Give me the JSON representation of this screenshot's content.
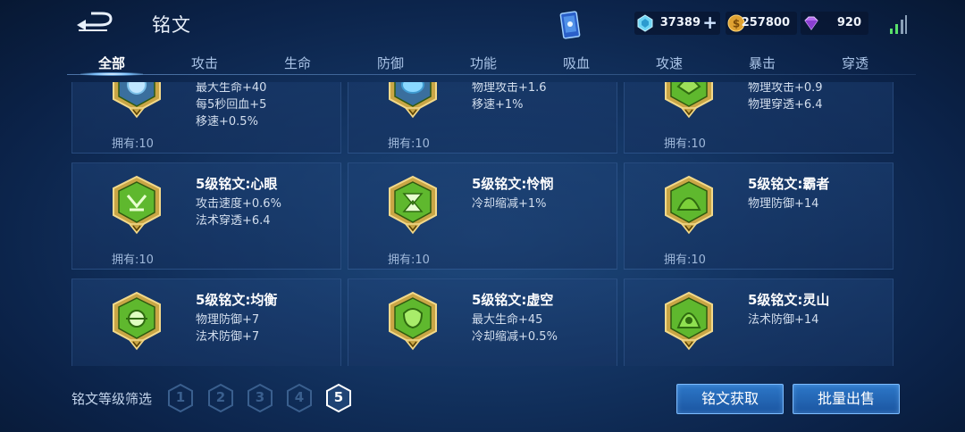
{
  "header": {
    "title": "铭文",
    "resources": [
      {
        "name": "gem",
        "icon": "gem-icon",
        "value": "37389"
      },
      {
        "name": "gold",
        "icon": "gold-coin-icon",
        "value": "257800"
      },
      {
        "name": "diamond",
        "icon": "purple-diamond-icon",
        "value": "920"
      }
    ],
    "plus": "+"
  },
  "tabs": [
    "全部",
    "攻击",
    "生命",
    "防御",
    "功能",
    "吸血",
    "攻速",
    "暴击",
    "穿透"
  ],
  "active_tab": 0,
  "cards": [
    {
      "name": "",
      "stats": [
        "最大生命+40",
        "每5秒回血+5",
        "移速+0.5%"
      ],
      "owned": "拥有:10"
    },
    {
      "name": "",
      "stats": [
        "物理攻击+1.6",
        "移速+1%"
      ],
      "owned": "拥有:10"
    },
    {
      "name": "",
      "stats": [
        "物理攻击+0.9",
        "物理穿透+6.4"
      ],
      "owned": "拥有:10"
    },
    {
      "name": "5级铭文:心眼",
      "stats": [
        "攻击速度+0.6%",
        "法术穿透+6.4"
      ],
      "owned": "拥有:10"
    },
    {
      "name": "5级铭文:怜悯",
      "stats": [
        "冷却缩减+1%"
      ],
      "owned": "拥有:10"
    },
    {
      "name": "5级铭文:霸者",
      "stats": [
        "物理防御+14"
      ],
      "owned": "拥有:10"
    },
    {
      "name": "5级铭文:均衡",
      "stats": [
        "物理防御+7",
        "法术防御+7"
      ],
      "owned": ""
    },
    {
      "name": "5级铭文:虚空",
      "stats": [
        "最大生命+45",
        "冷却缩减+0.5%"
      ],
      "owned": ""
    },
    {
      "name": "5级铭文:灵山",
      "stats": [
        "法术防御+14"
      ],
      "owned": ""
    }
  ],
  "filter": {
    "label": "铭文等级筛选",
    "levels": [
      "1",
      "2",
      "3",
      "4",
      "5"
    ],
    "active_level": "5"
  },
  "buttons": {
    "get_label": "铭文获取",
    "sell_label": "批量出售"
  },
  "colors": {
    "accent": "#2d78c9",
    "emblem_gold": "#c9a646",
    "emblem_green": "#5fb82e"
  }
}
